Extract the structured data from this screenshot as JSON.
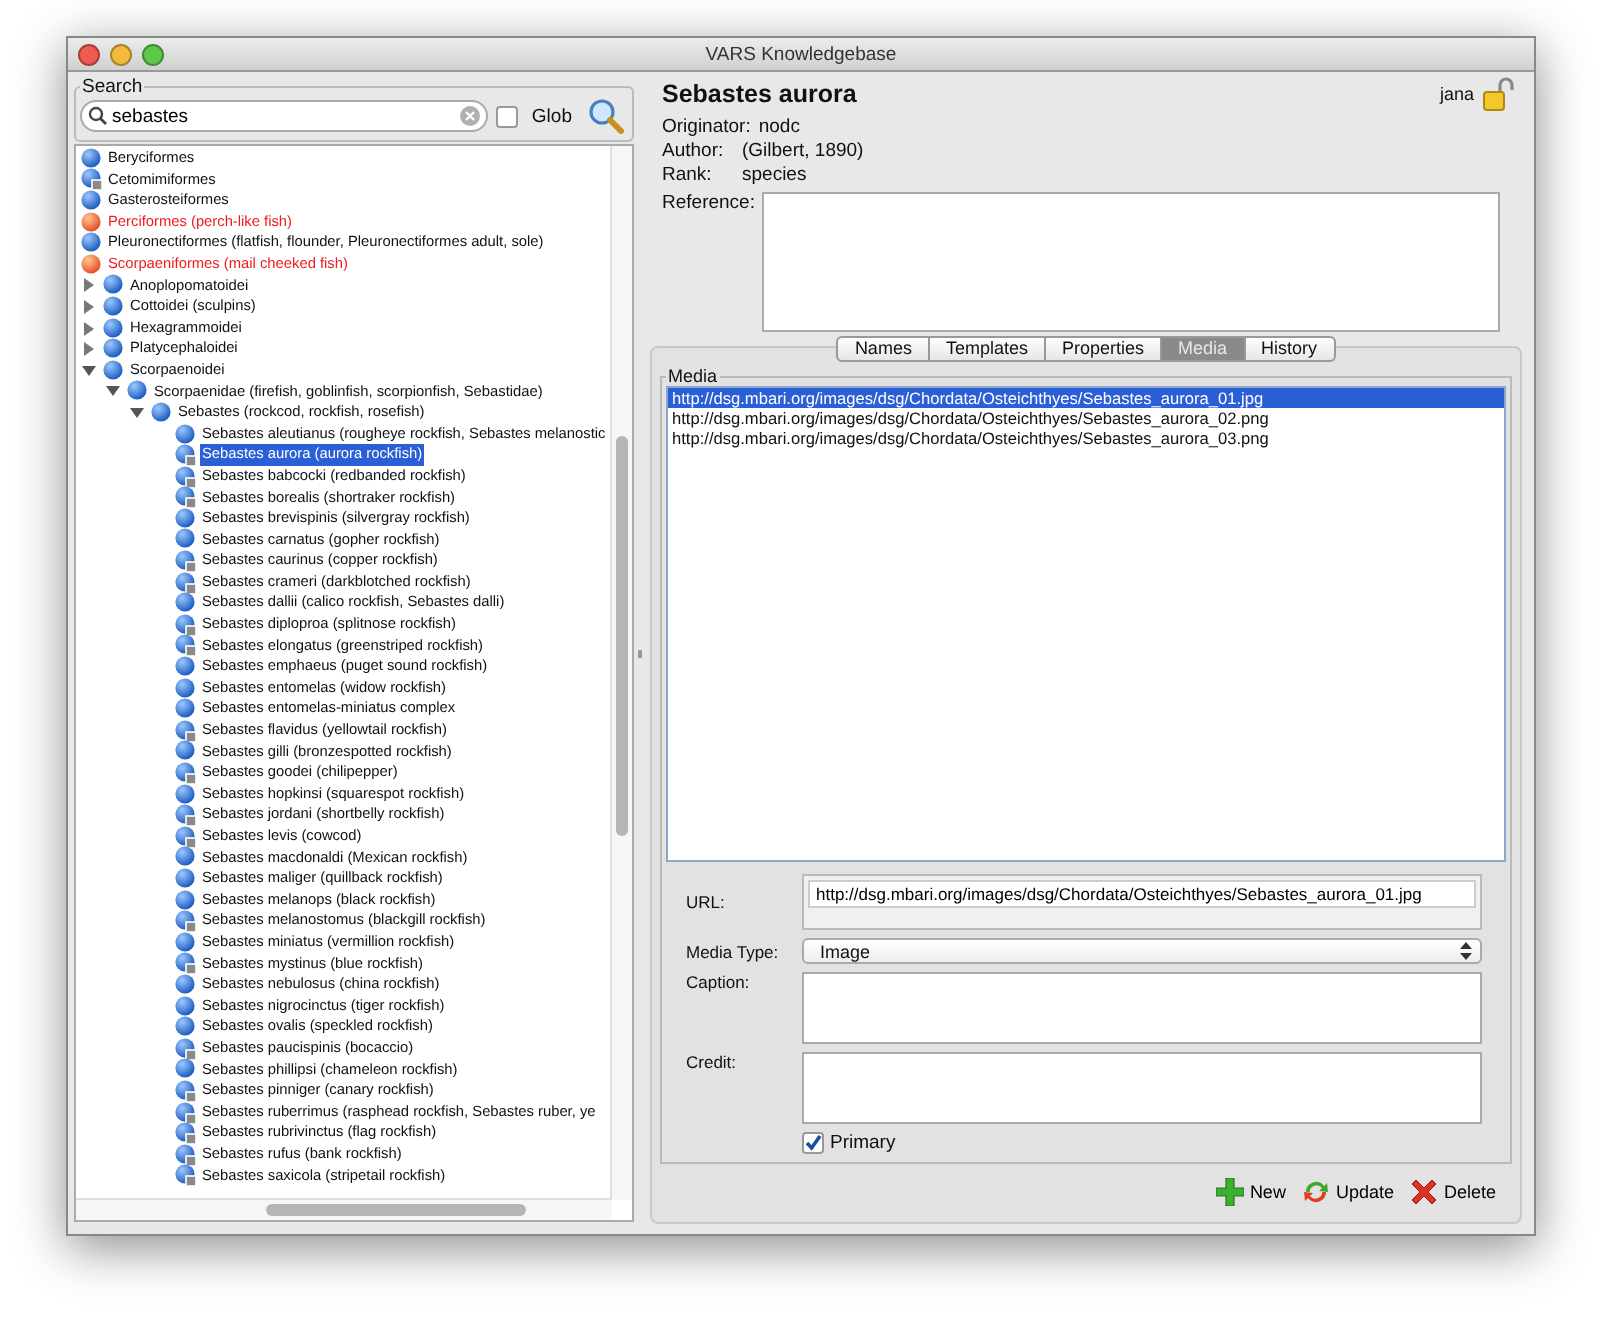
{
  "window": {
    "title": "VARS Knowledgebase"
  },
  "search": {
    "label": "Search",
    "value": "sebastes",
    "glob_label": "Glob",
    "glob_checked": false
  },
  "tree": [
    {
      "label": "Beryciformes",
      "highlighted": false,
      "has_media": false
    },
    {
      "label": "Cetomimiformes",
      "highlighted": false,
      "has_media": true
    },
    {
      "label": "Gasterosteiformes",
      "highlighted": false,
      "has_media": false
    },
    {
      "label": "Perciformes (perch-like fish)",
      "highlighted": true,
      "has_media": false
    },
    {
      "label": "Pleuronectiformes (flatfish, flounder, Pleuronectiformes adult, sole)",
      "highlighted": false,
      "has_media": false
    },
    {
      "label": "Scorpaeniformes (mail cheeked fish)",
      "highlighted": true,
      "has_media": false,
      "children": [
        {
          "label": "Anoplopomatoidei",
          "expanded": false,
          "has_media": false
        },
        {
          "label": "Cottoidei (sculpins)",
          "expanded": false,
          "has_media": false
        },
        {
          "label": "Hexagrammoidei",
          "expanded": false,
          "has_media": false
        },
        {
          "label": "Platycephaloidei",
          "expanded": false,
          "has_media": false
        },
        {
          "label": "Scorpaenoidei",
          "expanded": true,
          "has_media": false,
          "children": [
            {
              "label": "Scorpaenidae (firefish, goblinfish, scorpionfish, Sebastidae)",
              "expanded": true,
              "has_media": false,
              "children": [
                {
                  "label": "Sebastes (rockcod, rockfish, rosefish)",
                  "expanded": true,
                  "has_media": false,
                  "children": [
                    {
                      "label": "Sebastes aleutianus (rougheye rockfish, Sebastes melanostic",
                      "selected": false,
                      "has_media": false
                    },
                    {
                      "label": "Sebastes aurora (aurora rockfish)",
                      "selected": true,
                      "has_media": true
                    },
                    {
                      "label": "Sebastes babcocki (redbanded rockfish)",
                      "selected": false,
                      "has_media": true
                    },
                    {
                      "label": "Sebastes borealis (shortraker rockfish)",
                      "selected": false,
                      "has_media": true
                    },
                    {
                      "label": "Sebastes brevispinis (silvergray rockfish)",
                      "selected": false,
                      "has_media": false
                    },
                    {
                      "label": "Sebastes carnatus (gopher rockfish)",
                      "selected": false,
                      "has_media": false
                    },
                    {
                      "label": "Sebastes caurinus (copper rockfish)",
                      "selected": false,
                      "has_media": true
                    },
                    {
                      "label": "Sebastes crameri (darkblotched rockfish)",
                      "selected": false,
                      "has_media": true
                    },
                    {
                      "label": "Sebastes dallii (calico rockfish, Sebastes dalli)",
                      "selected": false,
                      "has_media": false
                    },
                    {
                      "label": "Sebastes diploproa (splitnose rockfish)",
                      "selected": false,
                      "has_media": true
                    },
                    {
                      "label": "Sebastes elongatus (greenstriped rockfish)",
                      "selected": false,
                      "has_media": true
                    },
                    {
                      "label": "Sebastes emphaeus (puget sound rockfish)",
                      "selected": false,
                      "has_media": false
                    },
                    {
                      "label": "Sebastes entomelas (widow rockfish)",
                      "selected": false,
                      "has_media": false
                    },
                    {
                      "label": "Sebastes entomelas-miniatus complex",
                      "selected": false,
                      "has_media": false
                    },
                    {
                      "label": "Sebastes flavidus (yellowtail rockfish)",
                      "selected": false,
                      "has_media": true
                    },
                    {
                      "label": "Sebastes gilli (bronzespotted rockfish)",
                      "selected": false,
                      "has_media": false
                    },
                    {
                      "label": "Sebastes goodei (chilipepper)",
                      "selected": false,
                      "has_media": true
                    },
                    {
                      "label": "Sebastes hopkinsi (squarespot rockfish)",
                      "selected": false,
                      "has_media": false
                    },
                    {
                      "label": "Sebastes jordani (shortbelly rockfish)",
                      "selected": false,
                      "has_media": true
                    },
                    {
                      "label": "Sebastes levis (cowcod)",
                      "selected": false,
                      "has_media": true
                    },
                    {
                      "label": "Sebastes macdonaldi (Mexican rockfish)",
                      "selected": false,
                      "has_media": false
                    },
                    {
                      "label": "Sebastes maliger (quillback rockfish)",
                      "selected": false,
                      "has_media": false
                    },
                    {
                      "label": "Sebastes melanops (black rockfish)",
                      "selected": false,
                      "has_media": false
                    },
                    {
                      "label": "Sebastes melanostomus (blackgill rockfish)",
                      "selected": false,
                      "has_media": true
                    },
                    {
                      "label": "Sebastes miniatus (vermillion rockfish)",
                      "selected": false,
                      "has_media": false
                    },
                    {
                      "label": "Sebastes mystinus (blue rockfish)",
                      "selected": false,
                      "has_media": true
                    },
                    {
                      "label": "Sebastes nebulosus (china rockfish)",
                      "selected": false,
                      "has_media": false
                    },
                    {
                      "label": "Sebastes nigrocinctus (tiger rockfish)",
                      "selected": false,
                      "has_media": false
                    },
                    {
                      "label": "Sebastes ovalis (speckled rockfish)",
                      "selected": false,
                      "has_media": false
                    },
                    {
                      "label": "Sebastes paucispinis (bocaccio)",
                      "selected": false,
                      "has_media": true
                    },
                    {
                      "label": "Sebastes phillipsi (chameleon rockfish)",
                      "selected": false,
                      "has_media": false
                    },
                    {
                      "label": "Sebastes pinniger (canary rockfish)",
                      "selected": false,
                      "has_media": true
                    },
                    {
                      "label": "Sebastes ruberrimus (rasphead rockfish, Sebastes ruber, ye",
                      "selected": false,
                      "has_media": true
                    },
                    {
                      "label": "Sebastes rubrivinctus (flag rockfish)",
                      "selected": false,
                      "has_media": true
                    },
                    {
                      "label": "Sebastes rufus (bank rockfish)",
                      "selected": false,
                      "has_media": true
                    },
                    {
                      "label": "Sebastes saxicola (stripetail rockfish)",
                      "selected": false,
                      "has_media": true
                    }
                  ]
                }
              ]
            }
          ]
        }
      ]
    }
  ],
  "detail": {
    "title": "Sebastes aurora",
    "user": "jana",
    "fields": [
      {
        "label": "Originator:",
        "value": "nodc"
      },
      {
        "label": "Author:",
        "value": "(Gilbert, 1890)"
      },
      {
        "label": "Rank:",
        "value": "species"
      }
    ],
    "reference_label": "Reference:"
  },
  "tabs": [
    {
      "label": "Names",
      "selected": false
    },
    {
      "label": "Templates",
      "selected": false
    },
    {
      "label": "Properties",
      "selected": false
    },
    {
      "label": "Media",
      "selected": true
    },
    {
      "label": "History",
      "selected": false
    }
  ],
  "media": {
    "group_label": "Media",
    "items": [
      {
        "url": "http://dsg.mbari.org/images/dsg/Chordata/Osteichthyes/Sebastes_aurora_01.jpg",
        "selected": true
      },
      {
        "url": "http://dsg.mbari.org/images/dsg/Chordata/Osteichthyes/Sebastes_aurora_02.png",
        "selected": false
      },
      {
        "url": "http://dsg.mbari.org/images/dsg/Chordata/Osteichthyes/Sebastes_aurora_03.png",
        "selected": false
      }
    ],
    "url_label": "URL:",
    "url": "http://dsg.mbari.org/images/dsg/Chordata/Osteichthyes/Sebastes_aurora_01.jpg",
    "type_label": "Media Type:",
    "type": "Image",
    "caption_label": "Caption:",
    "credit_label": "Credit:",
    "primary_label": "Primary",
    "primary_checked": true
  },
  "buttons": [
    {
      "kind": "new",
      "label": "New"
    },
    {
      "kind": "update",
      "label": "Update"
    },
    {
      "kind": "delete",
      "label": "Delete"
    }
  ]
}
